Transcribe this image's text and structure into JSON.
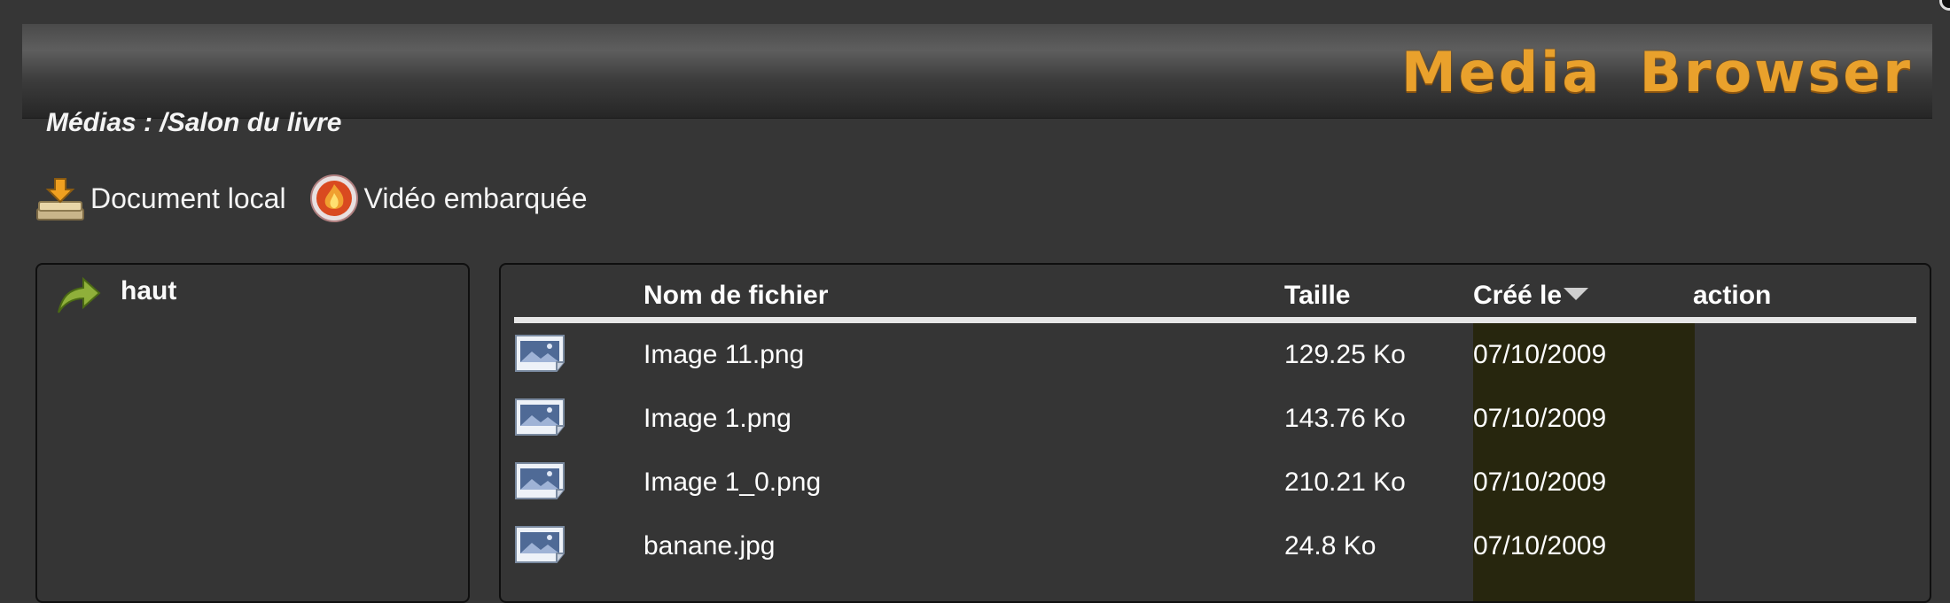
{
  "header": {
    "title": "Media Browser"
  },
  "breadcrumb": "Médias : /Salon du livre",
  "toolbar": {
    "local_doc_label": "Document local",
    "embedded_video_label": "Vidéo embarquée"
  },
  "left_panel": {
    "up_label": "haut"
  },
  "table": {
    "columns": {
      "filename": "Nom de fichier",
      "size": "Taille",
      "created": "Créé le",
      "action": "action"
    },
    "sort": {
      "column": "created",
      "direction": "descending"
    },
    "rows": [
      {
        "name": "Image 11.png",
        "size": "129.25 Ko",
        "date": "07/10/2009",
        "icon": "image-file-icon"
      },
      {
        "name": "Image 1.png",
        "size": "143.76 Ko",
        "date": "07/10/2009",
        "icon": "image-file-icon"
      },
      {
        "name": "Image 1_0.png",
        "size": "210.21 Ko",
        "date": "07/10/2009",
        "icon": "image-file-icon"
      },
      {
        "name": "banane.jpg",
        "size": "24.8 Ko",
        "date": "07/10/2009",
        "icon": "image-file-icon"
      }
    ]
  },
  "colors": {
    "background": "#363636",
    "brand": "#e9a12c",
    "date_highlight": "#27260e",
    "header_rule": "#e6e6e6"
  }
}
